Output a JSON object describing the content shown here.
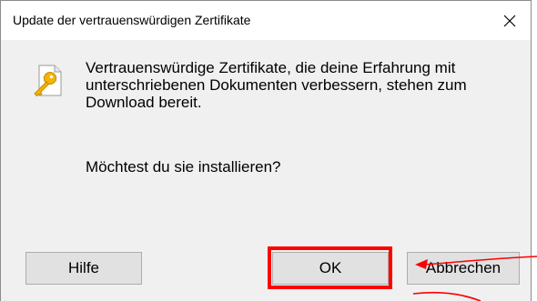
{
  "dialog": {
    "title": "Update der vertrauenswürdigen Zertifikate",
    "close_symbol": "✕",
    "icon": "certificate-key-icon",
    "message": "Vertrauenswürdige Zertifikate, die deine Erfahrung mit unterschriebenen Dokumenten verbessern, stehen zum Download bereit.",
    "question": "Möchtest du sie installieren?",
    "buttons": {
      "help": "Hilfe",
      "ok": "OK",
      "cancel": "Abbrechen"
    }
  },
  "annotation": {
    "highlight_target": "ok-button",
    "color": "#ff0000"
  },
  "colors": {
    "dialog_background": "#f0f0f0",
    "titlebar_background": "#ffffff",
    "button_face": "#e1e1e1",
    "button_border": "#adadad",
    "annotation": "#ff0000"
  }
}
